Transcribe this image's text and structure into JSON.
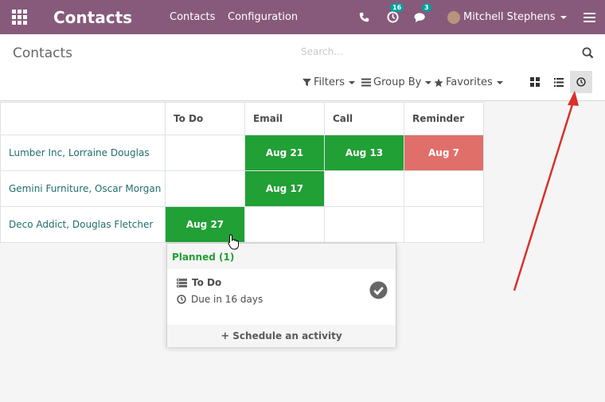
{
  "navbar": {
    "app_title": "Contacts",
    "menu": [
      "Contacts",
      "Configuration"
    ],
    "activity_count": "16",
    "message_count": "3",
    "user_name": "Mitchell Stephens"
  },
  "control_panel": {
    "breadcrumb": "Contacts",
    "search_placeholder": "Search...",
    "filters_label": "Filters",
    "groupby_label": "Group By",
    "favorites_label": "Favorites"
  },
  "grid": {
    "columns": [
      "To Do",
      "Email",
      "Call",
      "Reminder"
    ],
    "rows": [
      {
        "name": "Lumber Inc, Lorraine Douglas",
        "todo": "",
        "email": "Aug 21",
        "call": "Aug 13",
        "reminder": "Aug 7"
      },
      {
        "name": "Gemini Furniture, Oscar Morgan",
        "todo": "",
        "email": "Aug 17",
        "call": "",
        "reminder": ""
      },
      {
        "name": "Deco Addict, Douglas Fletcher",
        "todo": "Aug 27",
        "email": "",
        "call": "",
        "reminder": ""
      }
    ]
  },
  "popover": {
    "header": "Planned (1)",
    "activity_type": "To Do",
    "due": "Due in 16 days",
    "schedule_label": "Schedule an activity"
  },
  "colors": {
    "navbar": "#875a7b",
    "planned": "#21a035",
    "overdue": "#e06f6a",
    "link": "#206e6b",
    "annotation_arrow": "#d9302a"
  }
}
